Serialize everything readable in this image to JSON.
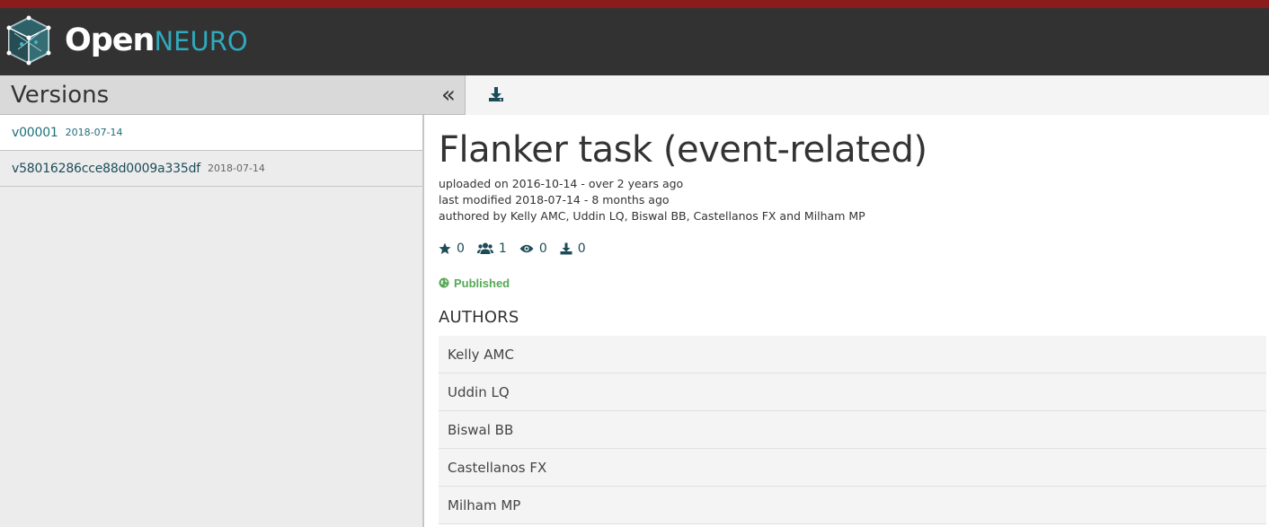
{
  "brand": {
    "open": "Open",
    "neuro": "NEURO"
  },
  "sidebar": {
    "title": "Versions",
    "collapse_icon": "double-chevron-left-icon",
    "versions": [
      {
        "name": "v00001",
        "date": "2018-07-14"
      },
      {
        "name": "v58016286cce88d0009a335df",
        "date": "2018-07-14"
      }
    ]
  },
  "toolbar": {
    "download_icon": "download-icon"
  },
  "dataset": {
    "title": "Flanker task (event-related)",
    "uploaded": "uploaded on 2016-10-14 - over 2 years ago",
    "modified": "last modified 2018-07-14 - 8 months ago",
    "authored": "authored by Kelly AMC, Uddin LQ, Biswal BB, Castellanos FX and Milham MP",
    "stats": {
      "stars": "0",
      "followers": "1",
      "views": "0",
      "downloads": "0"
    },
    "status": "Published",
    "authors_heading": "AUTHORS",
    "authors": [
      "Kelly AMC",
      "Uddin LQ",
      "Biswal BB",
      "Castellanos FX",
      "Milham MP"
    ]
  },
  "colors": {
    "topstrip": "#8b1c1c",
    "navbar": "#323232",
    "accent": "#30a9bd",
    "link": "#1d4c58",
    "published": "#56a956"
  }
}
